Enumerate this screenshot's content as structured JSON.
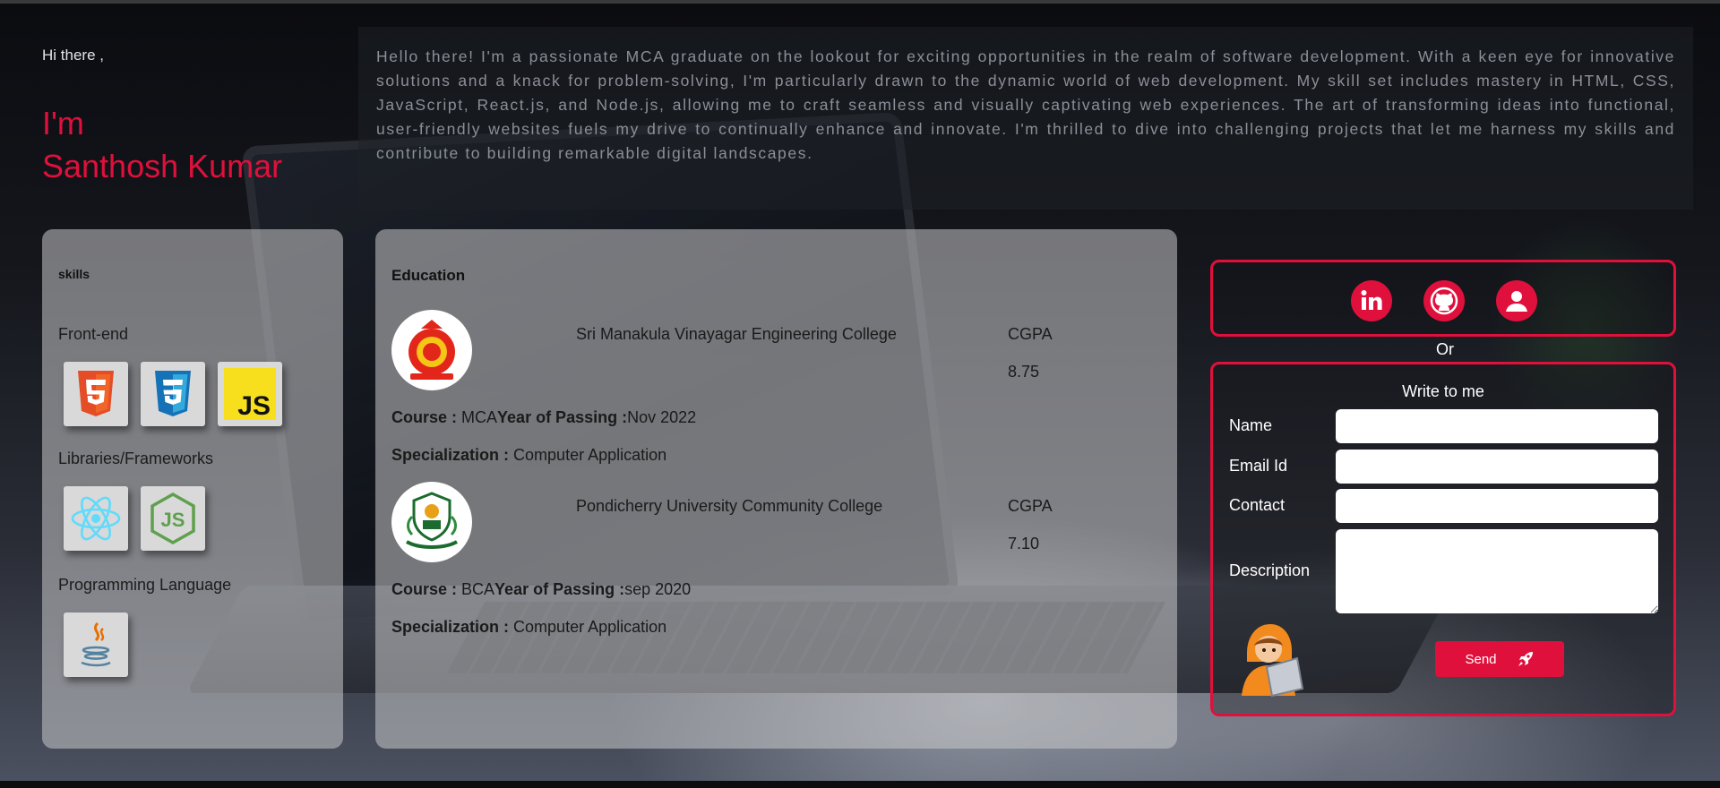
{
  "hero": {
    "greeting": "Hi there ,",
    "im": "I'm",
    "name": "Santhosh Kumar",
    "about": "Hello there! I'm a passionate MCA graduate on the lookout for exciting opportunities in the realm of software development. With a keen eye for innovative solutions and a knack for problem-solving, I'm particularly drawn to the dynamic world of web development. My skill set includes mastery in HTML, CSS, JavaScript, React.js, and Node.js, allowing me to craft seamless and visually captivating web experiences. The art of transforming ideas into functional, user-friendly websites fuels my drive to continually enhance and innovate. I'm thrilled to dive into challenging projects that let me harness my skills and contribute to building remarkable digital landscapes."
  },
  "skills": {
    "title": "skills",
    "groups": [
      {
        "label": "Front-end",
        "icons": [
          "html5-icon",
          "css3-icon",
          "javascript-icon"
        ]
      },
      {
        "label": "Libraries/Frameworks",
        "icons": [
          "react-icon",
          "nodejs-icon"
        ]
      },
      {
        "label": "Programming Language",
        "icons": [
          "java-icon"
        ]
      }
    ]
  },
  "education": {
    "title": "Education",
    "entries": [
      {
        "college": "Sri Manakula Vinayagar Engineering College",
        "cgpa_label": "CGPA",
        "cgpa": "8.75",
        "course_label": "Course :",
        "course": "MCA",
        "year_label": "Year of Passing :",
        "year": "Nov 2022",
        "spec_label": "Specialization :",
        "spec": "Computer Application"
      },
      {
        "college": "Pondicherry University Community College",
        "cgpa_label": "CGPA",
        "cgpa": "7.10",
        "course_label": "Course :",
        "course": "BCA",
        "year_label": "Year of Passing :",
        "year": "sep 2020",
        "spec_label": "Specialization :",
        "spec": "Computer Application"
      }
    ]
  },
  "social": {
    "icons": [
      "linkedin-icon",
      "github-icon",
      "profile-icon"
    ],
    "accent": "#e0103c"
  },
  "contact": {
    "or": "Or",
    "title": "Write to me",
    "name_label": "Name",
    "email_label": "Email Id",
    "contact_label": "Contact",
    "description_label": "Description",
    "send_label": "Send"
  }
}
